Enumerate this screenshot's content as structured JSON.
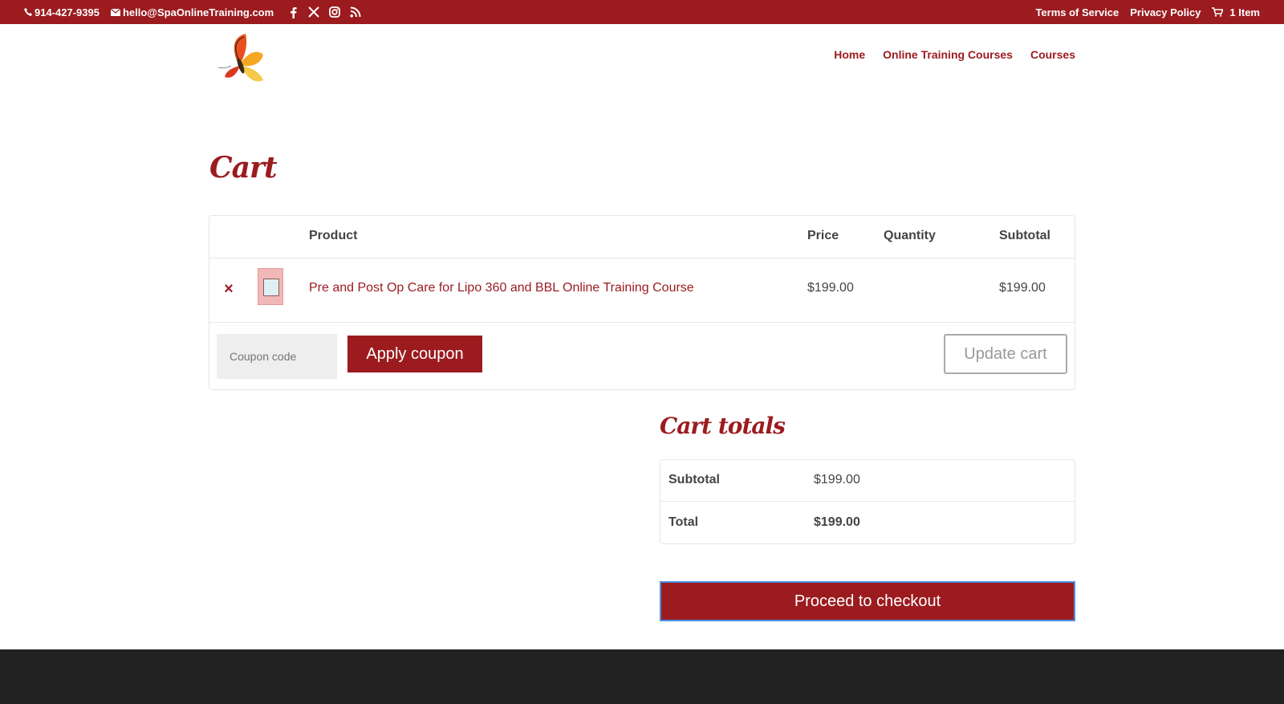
{
  "topbar": {
    "phone": "914-427-9395",
    "email": "hello@SpaOnlineTraining.com",
    "social_icons": [
      "facebook-icon",
      "x-icon",
      "instagram-icon",
      "rss-icon"
    ],
    "links": [
      "Terms of Service",
      "Privacy Policy"
    ],
    "cart_label": "1 Item"
  },
  "header": {
    "nav": [
      "Home",
      "Online Training Courses",
      "Courses"
    ]
  },
  "page": {
    "title": "Cart"
  },
  "cart": {
    "headers": {
      "product": "Product",
      "price": "Price",
      "quantity": "Quantity",
      "subtotal": "Subtotal"
    },
    "items": [
      {
        "name": "Pre and Post Op Care for Lipo 360 and BBL Online Training Course",
        "price": "$199.00",
        "subtotal": "$199.00"
      }
    ],
    "remove_symbol": "×",
    "coupon_placeholder": "Coupon code",
    "apply_label": "Apply coupon",
    "update_label": "Update cart"
  },
  "totals": {
    "title": "Cart totals",
    "subtotal_label": "Subtotal",
    "subtotal_value": "$199.00",
    "total_label": "Total",
    "total_value": "$199.00",
    "checkout_label": "Proceed to checkout"
  },
  "colors": {
    "brand": "#9b1b1f",
    "footer": "#222222"
  }
}
